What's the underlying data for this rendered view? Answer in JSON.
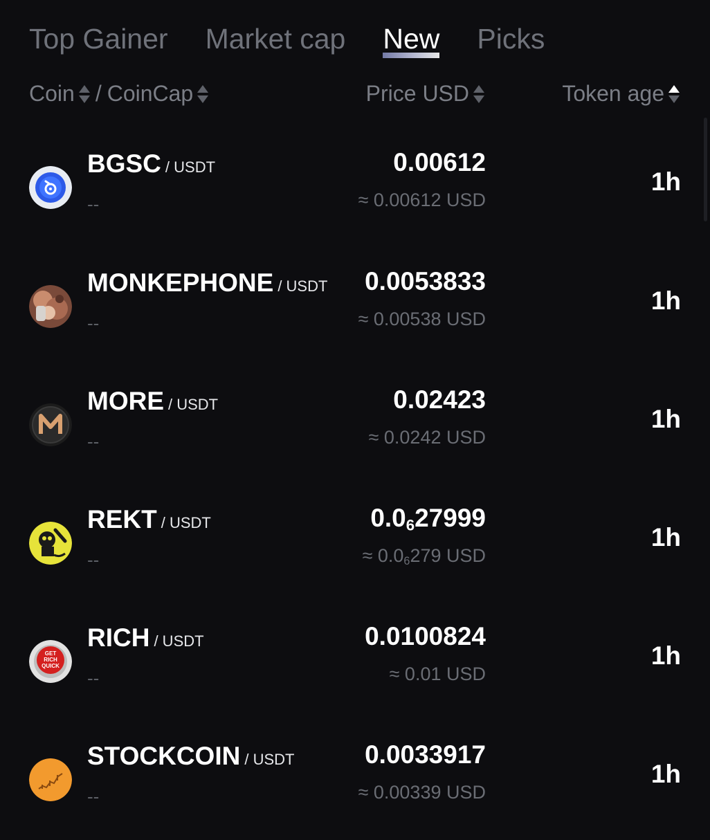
{
  "tabs": [
    {
      "label": "Top Gainer",
      "active": false
    },
    {
      "label": "Market cap",
      "active": false
    },
    {
      "label": "New",
      "active": true
    },
    {
      "label": "Picks",
      "active": false
    }
  ],
  "header": {
    "coin": "Coin",
    "separator": "/",
    "coincap": "CoinCap",
    "price": "Price USD",
    "age": "Token age"
  },
  "rows": [
    {
      "name": "BGSC",
      "pair": "/ USDT",
      "cap": "--",
      "price": "0.00612",
      "usd": "≈ 0.00612 USD",
      "age": "1h",
      "icon": "bgsc-logo-icon"
    },
    {
      "name": "MONKEPHONE",
      "pair": "/ USDT",
      "cap": "--",
      "price": "0.0053833",
      "usd": "≈ 0.00538 USD",
      "age": "1h",
      "icon": "monkephone-logo-icon"
    },
    {
      "name": "MORE",
      "pair": "/ USDT",
      "cap": "--",
      "price": "0.02423",
      "usd": "≈ 0.0242 USD",
      "age": "1h",
      "icon": "more-logo-icon"
    },
    {
      "name": "REKT",
      "pair": "/ USDT",
      "cap": "--",
      "price_prefix": "0.0",
      "price_sub": "6",
      "price_rest": "27999",
      "usd_prefix": "≈ 0.0",
      "usd_sub": "6",
      "usd_rest": "279 USD",
      "age": "1h",
      "icon": "rekt-logo-icon"
    },
    {
      "name": "RICH",
      "pair": "/ USDT",
      "cap": "--",
      "price": "0.0100824",
      "usd": "≈ 0.01 USD",
      "age": "1h",
      "icon": "rich-logo-icon",
      "logo_text": [
        "GET",
        "RICH",
        "QUICK"
      ]
    },
    {
      "name": "STOCKCOIN",
      "pair": "/ USDT",
      "cap": "--",
      "price": "0.0033917",
      "usd": "≈ 0.00339 USD",
      "age": "1h",
      "icon": "stockcoin-logo-icon"
    }
  ],
  "colors": {
    "background": "#0d0d10",
    "text_primary": "#ffffff",
    "text_muted": "#6a6d74",
    "tab_inactive": "#6f727a"
  }
}
